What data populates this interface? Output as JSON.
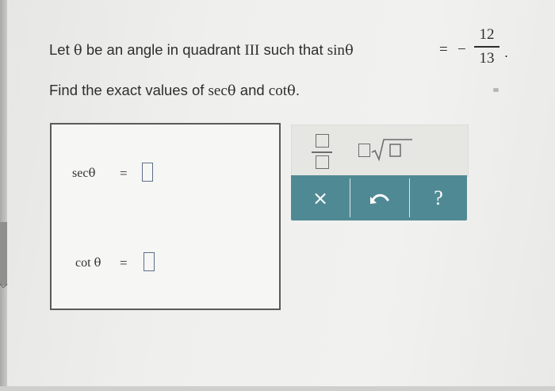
{
  "question": {
    "line1_prefix": "Let",
    "theta": "θ",
    "line1_middle": "be an angle in quadrant",
    "quadrant": "III",
    "line1_suffix": "such that",
    "sin": "sin",
    "equals": "=",
    "minus": "−",
    "fraction_numerator": "12",
    "fraction_denominator": "13",
    "period": ".",
    "line2_prefix": "Find the exact values of",
    "sec": "sec",
    "and": "and",
    "cot": "cot",
    "line2_suffix": "."
  },
  "answer_box": {
    "row1": {
      "func": "sec",
      "theta": "θ",
      "equals": "=",
      "value": ""
    },
    "row2": {
      "func": "cot",
      "theta": "θ",
      "equals": "=",
      "value": ""
    }
  },
  "keypad": {
    "icons": [
      "fraction-icon",
      "square-root-icon",
      "clear-icon",
      "undo-icon",
      "help-icon"
    ],
    "clear_label": "×",
    "help_label": "?",
    "accent_color": "#4f8a94"
  }
}
